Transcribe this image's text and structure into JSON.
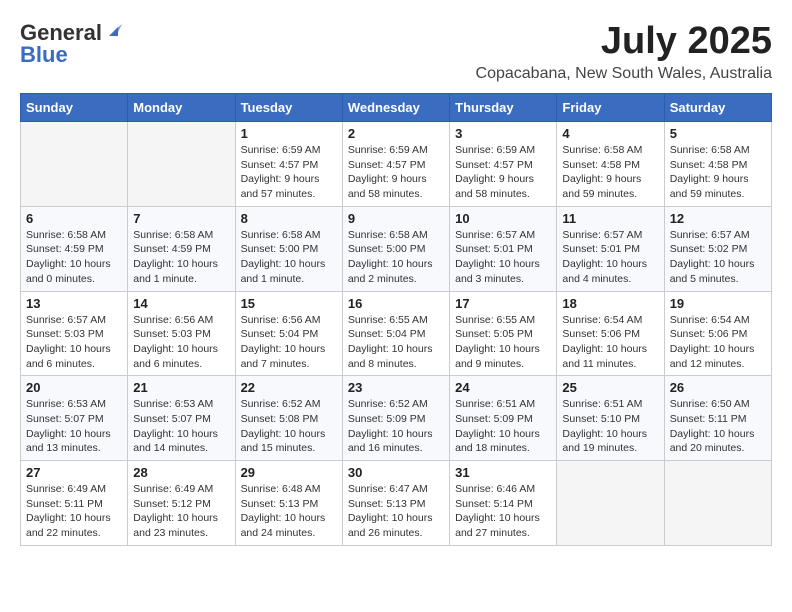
{
  "header": {
    "logo_general": "General",
    "logo_blue": "Blue",
    "month_year": "July 2025",
    "location": "Copacabana, New South Wales, Australia"
  },
  "calendar": {
    "headers": [
      "Sunday",
      "Monday",
      "Tuesday",
      "Wednesday",
      "Thursday",
      "Friday",
      "Saturday"
    ],
    "weeks": [
      [
        {
          "day": "",
          "info": ""
        },
        {
          "day": "",
          "info": ""
        },
        {
          "day": "1",
          "info": "Sunrise: 6:59 AM\nSunset: 4:57 PM\nDaylight: 9 hours\nand 57 minutes."
        },
        {
          "day": "2",
          "info": "Sunrise: 6:59 AM\nSunset: 4:57 PM\nDaylight: 9 hours\nand 58 minutes."
        },
        {
          "day": "3",
          "info": "Sunrise: 6:59 AM\nSunset: 4:57 PM\nDaylight: 9 hours\nand 58 minutes."
        },
        {
          "day": "4",
          "info": "Sunrise: 6:58 AM\nSunset: 4:58 PM\nDaylight: 9 hours\nand 59 minutes."
        },
        {
          "day": "5",
          "info": "Sunrise: 6:58 AM\nSunset: 4:58 PM\nDaylight: 9 hours\nand 59 minutes."
        }
      ],
      [
        {
          "day": "6",
          "info": "Sunrise: 6:58 AM\nSunset: 4:59 PM\nDaylight: 10 hours\nand 0 minutes."
        },
        {
          "day": "7",
          "info": "Sunrise: 6:58 AM\nSunset: 4:59 PM\nDaylight: 10 hours\nand 1 minute."
        },
        {
          "day": "8",
          "info": "Sunrise: 6:58 AM\nSunset: 5:00 PM\nDaylight: 10 hours\nand 1 minute."
        },
        {
          "day": "9",
          "info": "Sunrise: 6:58 AM\nSunset: 5:00 PM\nDaylight: 10 hours\nand 2 minutes."
        },
        {
          "day": "10",
          "info": "Sunrise: 6:57 AM\nSunset: 5:01 PM\nDaylight: 10 hours\nand 3 minutes."
        },
        {
          "day": "11",
          "info": "Sunrise: 6:57 AM\nSunset: 5:01 PM\nDaylight: 10 hours\nand 4 minutes."
        },
        {
          "day": "12",
          "info": "Sunrise: 6:57 AM\nSunset: 5:02 PM\nDaylight: 10 hours\nand 5 minutes."
        }
      ],
      [
        {
          "day": "13",
          "info": "Sunrise: 6:57 AM\nSunset: 5:03 PM\nDaylight: 10 hours\nand 6 minutes."
        },
        {
          "day": "14",
          "info": "Sunrise: 6:56 AM\nSunset: 5:03 PM\nDaylight: 10 hours\nand 6 minutes."
        },
        {
          "day": "15",
          "info": "Sunrise: 6:56 AM\nSunset: 5:04 PM\nDaylight: 10 hours\nand 7 minutes."
        },
        {
          "day": "16",
          "info": "Sunrise: 6:55 AM\nSunset: 5:04 PM\nDaylight: 10 hours\nand 8 minutes."
        },
        {
          "day": "17",
          "info": "Sunrise: 6:55 AM\nSunset: 5:05 PM\nDaylight: 10 hours\nand 9 minutes."
        },
        {
          "day": "18",
          "info": "Sunrise: 6:54 AM\nSunset: 5:06 PM\nDaylight: 10 hours\nand 11 minutes."
        },
        {
          "day": "19",
          "info": "Sunrise: 6:54 AM\nSunset: 5:06 PM\nDaylight: 10 hours\nand 12 minutes."
        }
      ],
      [
        {
          "day": "20",
          "info": "Sunrise: 6:53 AM\nSunset: 5:07 PM\nDaylight: 10 hours\nand 13 minutes."
        },
        {
          "day": "21",
          "info": "Sunrise: 6:53 AM\nSunset: 5:07 PM\nDaylight: 10 hours\nand 14 minutes."
        },
        {
          "day": "22",
          "info": "Sunrise: 6:52 AM\nSunset: 5:08 PM\nDaylight: 10 hours\nand 15 minutes."
        },
        {
          "day": "23",
          "info": "Sunrise: 6:52 AM\nSunset: 5:09 PM\nDaylight: 10 hours\nand 16 minutes."
        },
        {
          "day": "24",
          "info": "Sunrise: 6:51 AM\nSunset: 5:09 PM\nDaylight: 10 hours\nand 18 minutes."
        },
        {
          "day": "25",
          "info": "Sunrise: 6:51 AM\nSunset: 5:10 PM\nDaylight: 10 hours\nand 19 minutes."
        },
        {
          "day": "26",
          "info": "Sunrise: 6:50 AM\nSunset: 5:11 PM\nDaylight: 10 hours\nand 20 minutes."
        }
      ],
      [
        {
          "day": "27",
          "info": "Sunrise: 6:49 AM\nSunset: 5:11 PM\nDaylight: 10 hours\nand 22 minutes."
        },
        {
          "day": "28",
          "info": "Sunrise: 6:49 AM\nSunset: 5:12 PM\nDaylight: 10 hours\nand 23 minutes."
        },
        {
          "day": "29",
          "info": "Sunrise: 6:48 AM\nSunset: 5:13 PM\nDaylight: 10 hours\nand 24 minutes."
        },
        {
          "day": "30",
          "info": "Sunrise: 6:47 AM\nSunset: 5:13 PM\nDaylight: 10 hours\nand 26 minutes."
        },
        {
          "day": "31",
          "info": "Sunrise: 6:46 AM\nSunset: 5:14 PM\nDaylight: 10 hours\nand 27 minutes."
        },
        {
          "day": "",
          "info": ""
        },
        {
          "day": "",
          "info": ""
        }
      ]
    ]
  }
}
